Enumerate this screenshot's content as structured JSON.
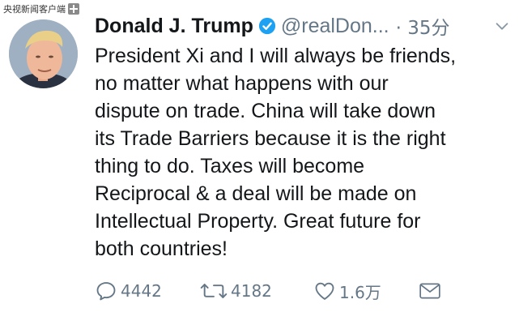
{
  "watermark": {
    "text": "央视新闻客户端"
  },
  "tweet": {
    "author_name": "Donald J. Trump",
    "handle": "@realDon...",
    "time": "· 35分",
    "text": "President Xi and I will always be friends,\nno matter what happens with our\ndispute on trade. China will take down\nits Trade Barriers because it is the right\nthing to do. Taxes will become\nReciprocal & a deal will be made on\nIntellectual Property. Great future for\nboth countries!"
  },
  "actions": {
    "reply_count": "4442",
    "retweet_count": "4182",
    "like_count": "1.6万"
  },
  "colors": {
    "verified": "#1da1f2",
    "secondary_text": "#657786",
    "primary_text": "#14171a"
  },
  "icons": [
    "avatar",
    "verified-badge-icon",
    "chevron-down-icon",
    "reply-icon",
    "retweet-icon",
    "like-icon",
    "direct-message-icon"
  ]
}
